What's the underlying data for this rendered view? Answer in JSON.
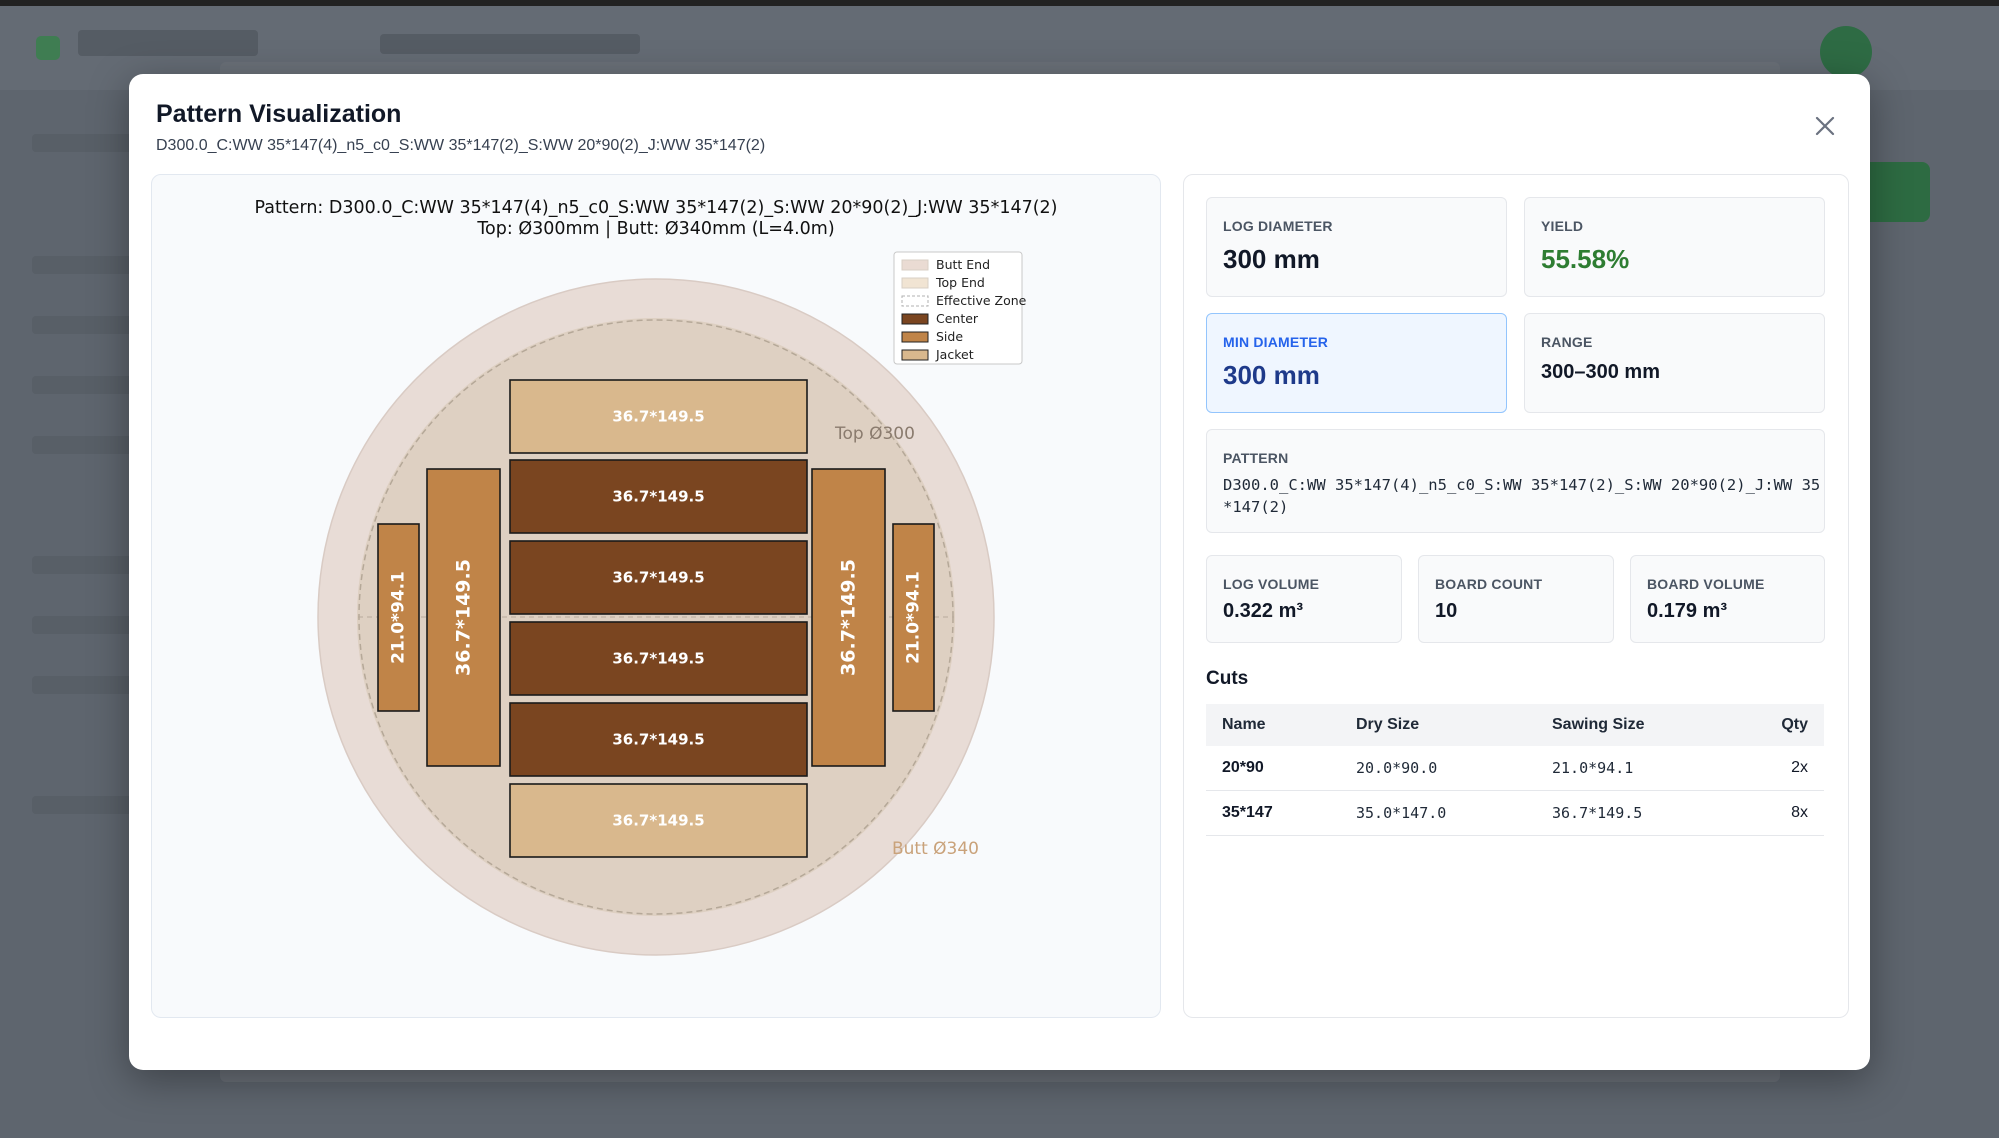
{
  "modal": {
    "title": "Pattern Visualization",
    "subtitle": "D300.0_C:WW 35*147(4)_n5_c0_S:WW 35*147(2)_S:WW 20*90(2)_J:WW 35*147(2)",
    "close_icon": "close-icon"
  },
  "diagram": {
    "title_line1": "Pattern: D300.0_C:WW 35*147(4)_n5_c0_S:WW 35*147(2)_S:WW 20*90(2)_J:WW 35*147(2)",
    "title_line2": "Top: Ø300mm | Butt: Ø340mm (L=4.0m)",
    "top_label": "Top Ø300",
    "butt_label": "Butt Ø340",
    "legend": [
      {
        "label": "Butt End",
        "color": "#eadbd3",
        "style": "fill"
      },
      {
        "label": "Top End",
        "color": "#f1e4d3",
        "style": "fill"
      },
      {
        "label": "Effective Zone",
        "color": "#b0b0b0",
        "style": "dashed"
      },
      {
        "label": "Center",
        "color": "#7a4520",
        "style": "fill"
      },
      {
        "label": "Side",
        "color": "#c08448",
        "style": "fill"
      },
      {
        "label": "Jacket",
        "color": "#d9b88d",
        "style": "fill"
      }
    ],
    "boards": [
      {
        "role": "jacket",
        "label": "36.7*149.5"
      },
      {
        "role": "center",
        "label": "36.7*149.5"
      },
      {
        "role": "center",
        "label": "36.7*149.5"
      },
      {
        "role": "center",
        "label": "36.7*149.5"
      },
      {
        "role": "center",
        "label": "36.7*149.5"
      },
      {
        "role": "jacket",
        "label": "36.7*149.5"
      },
      {
        "role": "side",
        "label": "36.7*149.5"
      },
      {
        "role": "side",
        "label": "36.7*149.5"
      },
      {
        "role": "side",
        "label": "21.0*94.1"
      },
      {
        "role": "side",
        "label": "21.0*94.1"
      }
    ]
  },
  "stats": {
    "log_diameter": {
      "label": "LOG DIAMETER",
      "value": "300 mm"
    },
    "yield": {
      "label": "YIELD",
      "value": "55.58%",
      "color": "#2e7d32"
    },
    "min_diameter": {
      "label": "MIN DIAMETER",
      "value": "300 mm",
      "color": "#1e3a8a"
    },
    "range": {
      "label": "RANGE",
      "value": "300–300 mm"
    },
    "pattern": {
      "label": "PATTERN",
      "value": "D300.0_C:WW 35*147(4)_n5_c0_S:WW 35*147(2)_S:WW 20*90(2)_J:WW 35*147(2)"
    },
    "log_volume": {
      "label": "LOG VOLUME",
      "value": "0.322 m³"
    },
    "board_count": {
      "label": "BOARD COUNT",
      "value": "10"
    },
    "board_volume": {
      "label": "BOARD VOLUME",
      "value": "0.179 m³"
    }
  },
  "cuts": {
    "title": "Cuts",
    "headers": [
      "Name",
      "Dry Size",
      "Sawing Size",
      "Qty"
    ],
    "rows": [
      {
        "name": "20*90",
        "dry": "20.0*90.0",
        "sawing": "21.0*94.1",
        "qty": "2x"
      },
      {
        "name": "35*147",
        "dry": "35.0*147.0",
        "sawing": "36.7*149.5",
        "qty": "8x"
      }
    ]
  }
}
